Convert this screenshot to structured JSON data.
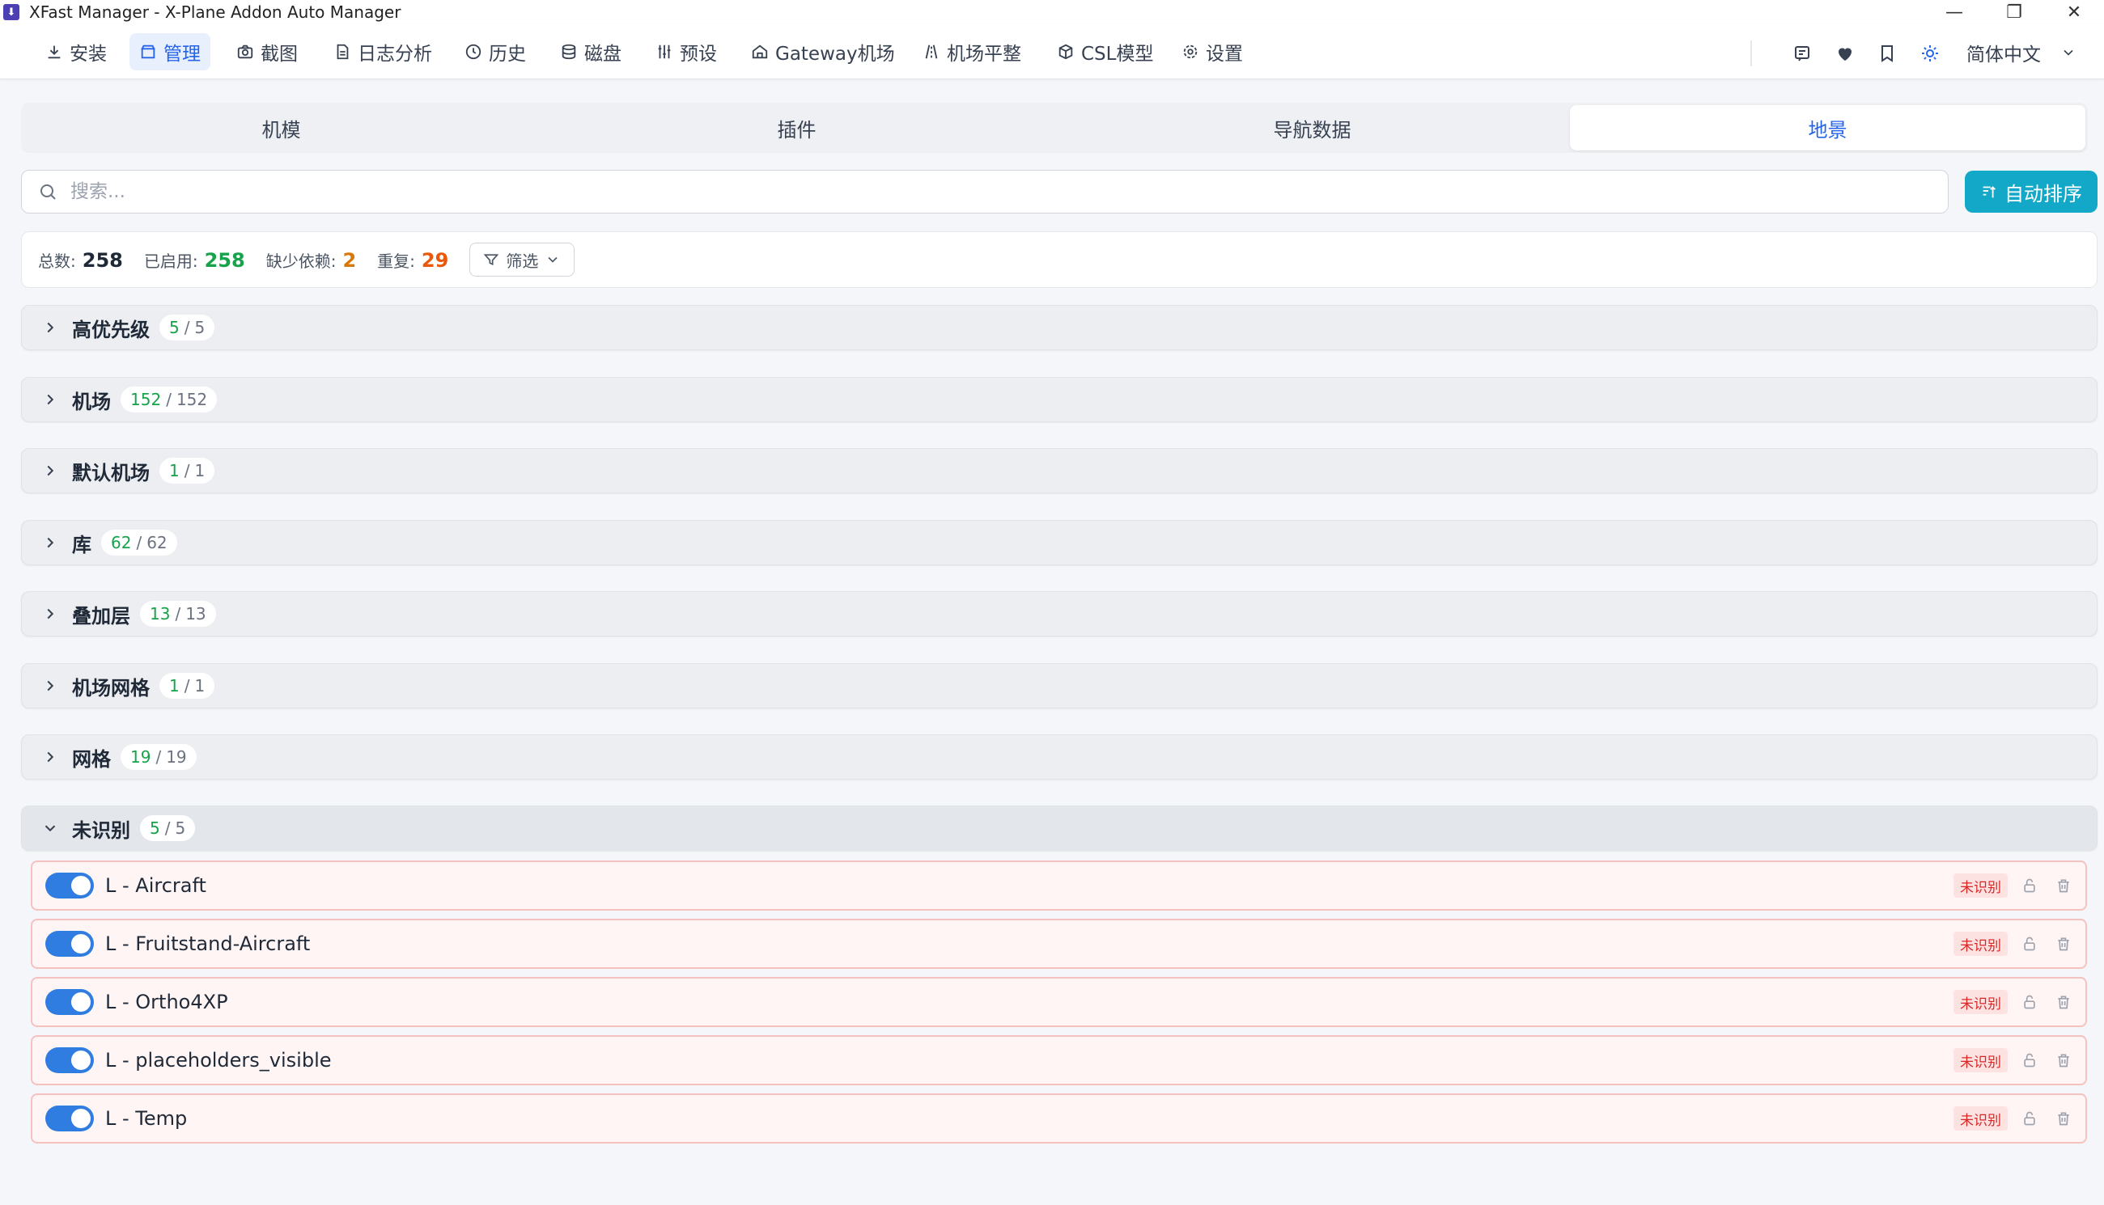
{
  "window": {
    "title": "XFast Manager - X-Plane Addon Auto Manager",
    "controls": [
      "—",
      "❐",
      "✕"
    ]
  },
  "nav": {
    "items": [
      {
        "label": "安装",
        "icon": "download-icon"
      },
      {
        "label": "管理",
        "icon": "box-icon",
        "active": true
      },
      {
        "label": "截图",
        "icon": "camera-icon"
      },
      {
        "label": "日志分析",
        "icon": "file-icon"
      },
      {
        "label": "历史",
        "icon": "clock-icon"
      },
      {
        "label": "磁盘",
        "icon": "database-icon"
      },
      {
        "label": "预设",
        "icon": "sliders-icon"
      },
      {
        "label": "Gateway机场",
        "icon": "home-icon"
      },
      {
        "label": "机场平整",
        "icon": "road-icon"
      },
      {
        "label": "CSL模型",
        "icon": "package-icon"
      },
      {
        "label": "设置",
        "icon": "gear-icon"
      }
    ],
    "tools": [
      "message-icon",
      "heart-icon",
      "bookmark-icon",
      "sun-icon"
    ],
    "language": "简体中文"
  },
  "tabs": [
    {
      "label": "机模"
    },
    {
      "label": "插件"
    },
    {
      "label": "导航数据"
    },
    {
      "label": "地景",
      "active": true
    }
  ],
  "search": {
    "placeholder": "搜索...",
    "value": ""
  },
  "auto_sort_label": "自动排序",
  "stats": {
    "total_label": "总数:",
    "total": "258",
    "enabled_label": "已启用:",
    "enabled": "258",
    "missing_label": "缺少依赖:",
    "missing": "2",
    "dup_label": "重复:",
    "dup": "29",
    "filter_label": "筛选"
  },
  "groups": [
    {
      "name": "高优先级",
      "enabled": "5",
      "sep": "/",
      "total": "5"
    },
    {
      "name": "机场",
      "enabled": "152",
      "sep": "/",
      "total": "152"
    },
    {
      "name": "默认机场",
      "enabled": "1",
      "sep": "/",
      "total": "1"
    },
    {
      "name": "库",
      "enabled": "62",
      "sep": "/",
      "total": "62"
    },
    {
      "name": "叠加层",
      "enabled": "13",
      "sep": "/",
      "total": "13"
    },
    {
      "name": "机场网格",
      "enabled": "1",
      "sep": "/",
      "total": "1"
    },
    {
      "name": "网格",
      "enabled": "19",
      "sep": "/",
      "total": "19"
    },
    {
      "name": "未识别",
      "enabled": "5",
      "sep": "/",
      "total": "5",
      "expanded": true
    }
  ],
  "items": [
    {
      "name": "L - Aircraft",
      "badge": "未识别",
      "enabled": true
    },
    {
      "name": "L - Fruitstand-Aircraft",
      "badge": "未识别",
      "enabled": true
    },
    {
      "name": "L - Ortho4XP",
      "badge": "未识别",
      "enabled": true
    },
    {
      "name": "L - placeholders_visible",
      "badge": "未识别",
      "enabled": true
    },
    {
      "name": "L - Temp",
      "badge": "未识别",
      "enabled": true
    }
  ],
  "colors": {
    "accent": "#2563eb",
    "primary_button": "#13a8c8",
    "toggle_on": "#2f7de1",
    "enabled_count": "#16a34a",
    "missing": "#d97706",
    "duplicate": "#ea580c",
    "unrecognized_badge": "#dc2626"
  }
}
